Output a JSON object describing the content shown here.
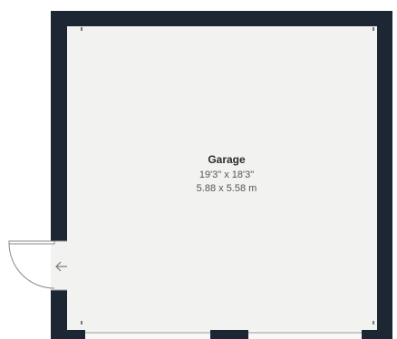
{
  "room": {
    "name": "Garage",
    "dimensions_imperial": "19'3\" x 18'3\"",
    "dimensions_metric": "5.88 x 5.58 m"
  },
  "colors": {
    "wall": "#1c2733",
    "floor": "#f2f2f1",
    "door_swing": "#8a8a8a",
    "arrow": "#7a7a7a"
  },
  "icons": {
    "entrance": "arrow-left-icon"
  }
}
